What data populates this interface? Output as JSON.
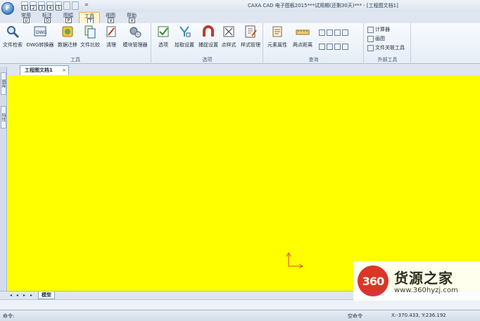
{
  "app": {
    "title": "CAXA CAD 电子图板2015***试用期(还剩30天)*** - [工程图文档1]",
    "button_label": "F"
  },
  "quick_access": {
    "keytips": [
      "1",
      "2",
      "3",
      "4",
      "5"
    ],
    "extra": "="
  },
  "ribbon_tabs": [
    {
      "label": "常用",
      "keytip": "U"
    },
    {
      "label": "标注",
      "keytip": "D"
    },
    {
      "label": "图幅",
      "keytip": "P"
    },
    {
      "label": "工具",
      "keytip": "T"
    },
    {
      "label": "视图",
      "keytip": "V"
    },
    {
      "label": "帮助",
      "keytip": "V"
    }
  ],
  "groups": {
    "tools": {
      "title": "工具",
      "buttons": [
        "文件检索",
        "DWG转换器",
        "数据迁移",
        "文件比较",
        "清理",
        "模块管理器"
      ]
    },
    "options": {
      "title": "选项",
      "buttons": [
        "选项",
        "拾取设置",
        "捕捉设置",
        "点样式",
        "样式管理"
      ]
    },
    "query": {
      "title": "查询",
      "buttons": [
        "元素属性",
        "两点距离"
      ]
    },
    "external": {
      "title": "外部工具",
      "items": [
        "计算器",
        "画图",
        "文件关联工具"
      ]
    }
  },
  "document": {
    "tab": "工程图文档1",
    "close": "×"
  },
  "side_tabs": [
    "图库",
    "特性"
  ],
  "layout_tabs": {
    "model": "模型",
    "nav": [
      "◂",
      "◂",
      "▸",
      "▸"
    ]
  },
  "status": {
    "command_label": "命令:",
    "mode": "空命令",
    "coords": "X:-370.433, Y:236.192"
  },
  "watermark": {
    "logo": "360",
    "name": "货源之家",
    "url": "www.360hyzj.com"
  },
  "colors": {
    "canvas": "#ffff00",
    "accent": "#e0b14a",
    "brand": "#d9262b"
  }
}
